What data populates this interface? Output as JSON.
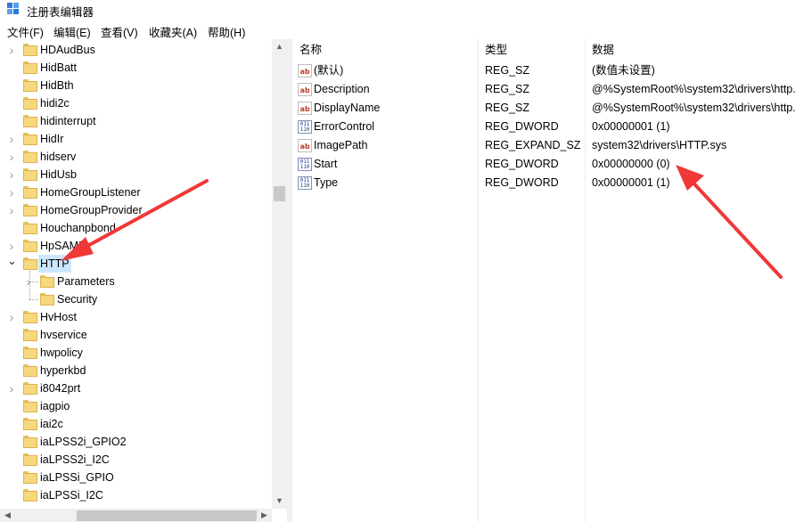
{
  "window": {
    "title": "注册表编辑器",
    "icon": "registry-editor-icon"
  },
  "menu": [
    "文件(F)",
    "编辑(E)",
    "查看(V)",
    "收藏夹(A)",
    "帮助(H)"
  ],
  "tree": [
    {
      "label": "HDAudBus",
      "expandable": true,
      "level": 0
    },
    {
      "label": "HidBatt",
      "expandable": false,
      "level": 0
    },
    {
      "label": "HidBth",
      "expandable": false,
      "level": 0
    },
    {
      "label": "hidi2c",
      "expandable": false,
      "level": 0
    },
    {
      "label": "hidinterrupt",
      "expandable": false,
      "level": 0
    },
    {
      "label": "HidIr",
      "expandable": true,
      "level": 0
    },
    {
      "label": "hidserv",
      "expandable": true,
      "level": 0
    },
    {
      "label": "HidUsb",
      "expandable": true,
      "level": 0
    },
    {
      "label": "HomeGroupListener",
      "expandable": true,
      "level": 0
    },
    {
      "label": "HomeGroupProvider",
      "expandable": true,
      "level": 0
    },
    {
      "label": "Houchanpbond",
      "expandable": false,
      "level": 0
    },
    {
      "label": "HpSAMD",
      "expandable": true,
      "level": 0
    },
    {
      "label": "HTTP",
      "expandable": true,
      "expanded": true,
      "selected": true,
      "level": 0
    },
    {
      "label": "Parameters",
      "expandable": true,
      "level": 1
    },
    {
      "label": "Security",
      "expandable": false,
      "level": 1
    },
    {
      "label": "HvHost",
      "expandable": true,
      "level": 0
    },
    {
      "label": "hvservice",
      "expandable": false,
      "level": 0
    },
    {
      "label": "hwpolicy",
      "expandable": false,
      "level": 0
    },
    {
      "label": "hyperkbd",
      "expandable": false,
      "level": 0
    },
    {
      "label": "i8042prt",
      "expandable": true,
      "level": 0
    },
    {
      "label": "iagpio",
      "expandable": false,
      "level": 0
    },
    {
      "label": "iai2c",
      "expandable": false,
      "level": 0
    },
    {
      "label": "iaLPSS2i_GPIO2",
      "expandable": false,
      "level": 0
    },
    {
      "label": "iaLPSS2i_I2C",
      "expandable": false,
      "level": 0
    },
    {
      "label": "iaLPSSi_GPIO",
      "expandable": false,
      "level": 0
    },
    {
      "label": "iaLPSSi_I2C",
      "expandable": false,
      "level": 0
    }
  ],
  "columns": {
    "name": "名称",
    "type": "类型",
    "data": "数据"
  },
  "values": [
    {
      "name": "(默认)",
      "type": "REG_SZ",
      "data": "(数值未设置)",
      "icon": "string-value-icon"
    },
    {
      "name": "Description",
      "type": "REG_SZ",
      "data": "@%SystemRoot%\\system32\\drivers\\http.",
      "icon": "string-value-icon"
    },
    {
      "name": "DisplayName",
      "type": "REG_SZ",
      "data": "@%SystemRoot%\\system32\\drivers\\http.",
      "icon": "string-value-icon"
    },
    {
      "name": "ErrorControl",
      "type": "REG_DWORD",
      "data": "0x00000001 (1)",
      "icon": "binary-value-icon"
    },
    {
      "name": "ImagePath",
      "type": "REG_EXPAND_SZ",
      "data": "system32\\drivers\\HTTP.sys",
      "icon": "string-value-icon"
    },
    {
      "name": "Start",
      "type": "REG_DWORD",
      "data": "0x00000000 (0)",
      "icon": "binary-value-icon"
    },
    {
      "name": "Type",
      "type": "REG_DWORD",
      "data": "0x00000001 (1)",
      "icon": "binary-value-icon"
    }
  ],
  "annotation_color": "#f03838"
}
